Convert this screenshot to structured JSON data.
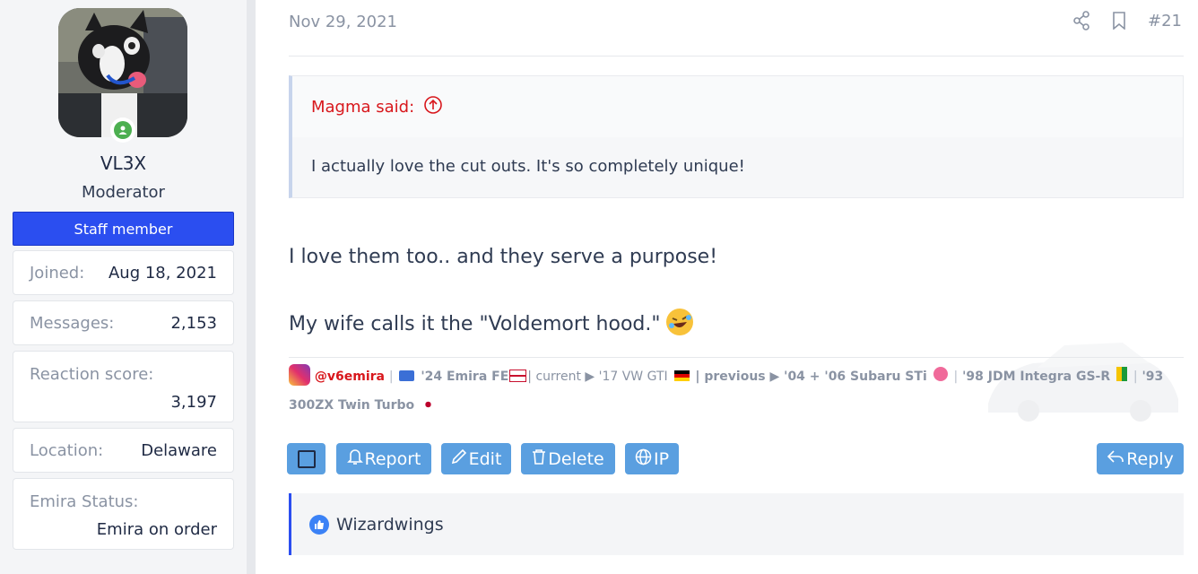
{
  "author": {
    "username": "VL3X",
    "user_title": "Moderator",
    "banner": "Staff member",
    "stats": {
      "joined_label": "Joined:",
      "joined_value": "Aug 18, 2021",
      "messages_label": "Messages:",
      "messages_value": "2,153",
      "reaction_label": "Reaction score:",
      "reaction_value": "3,197",
      "location_label": "Location:",
      "location_value": "Delaware",
      "status_label": "Emira Status:",
      "status_value": "Emira on order"
    }
  },
  "post": {
    "date": "Nov 29, 2021",
    "number": "#21",
    "quote": {
      "author_line": "Magma said:",
      "text": "I actually love the cut outs. It's so completely unique!"
    },
    "body_lines": [
      "I love them too.. and they serve a purpose!",
      "My wife calls it the \"Voldemort hood.\""
    ],
    "signature": {
      "handle": "@v6emira",
      "sep": "|",
      "part1": "'24 Emira FE",
      "part2": "| current ▶ '17 VW GTI",
      "part3": "| previous ▶ '04 + '06 Subaru STi",
      "part4": "'98 JDM Integra GS-R",
      "part5": "'93 300ZX",
      "part6": "Twin Turbo"
    }
  },
  "actions": {
    "report": "Report",
    "edit": "Edit",
    "delete": "Delete",
    "ip": "IP",
    "reply": "Reply"
  },
  "reactions": {
    "users": "Wizardwings"
  },
  "colors": {
    "staff_banner": "#2b4ef0",
    "button_bg": "#5a9fe0",
    "quote_author": "#d8171c",
    "reaction_border": "#2b4ef0",
    "online": "#4caf50"
  }
}
